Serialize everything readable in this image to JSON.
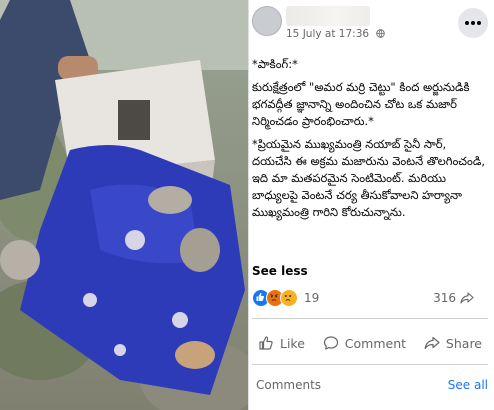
{
  "post": {
    "timestamp": "15 July at 17:36",
    "paragraphs": [
      "*పాకింగ్:*",
      "కురుక్షేత్రంలో \"అమర మర్రి చెట్టు\" కింద అర్జునుడికి భగవద్గీత జ్ఞానాన్ని అందించిన చోట ఒక మజార్ నిర్మించడం ప్రారంభించారు.*",
      "*ప్రియమైన ముఖ్యమంత్రి నయాబ్ సైనీ సార్, దయచేసి ఈ అక్రమ మజారును వెంటనే తొలగించండి, ఇది మా మతపరమైన సెంటిమెంట్. మరియు బాధ్యులపై వెంటనే చర్య తీసుకోవాలని హర్యానా ముఖ్యమంత్రి గారిని కోరుచున్నాను."
    ],
    "see_less_label": "See less",
    "reaction_count": "19",
    "share_count": "316",
    "actions": {
      "like": "Like",
      "comment": "Comment",
      "share": "Share"
    },
    "comments_label": "Comments",
    "see_all_label": "See all"
  },
  "colors": {
    "link_blue": "#1877f2",
    "meta_gray": "#65676b",
    "like_blue": "#1877f2",
    "angry_orange": "#e9710f",
    "sad_yellow": "#f7b125"
  },
  "icons": {
    "more": "more-icon",
    "globe": "globe-icon",
    "like": "thumbs-up-icon",
    "comment": "speech-bubble-icon",
    "share": "share-arrow-icon"
  }
}
